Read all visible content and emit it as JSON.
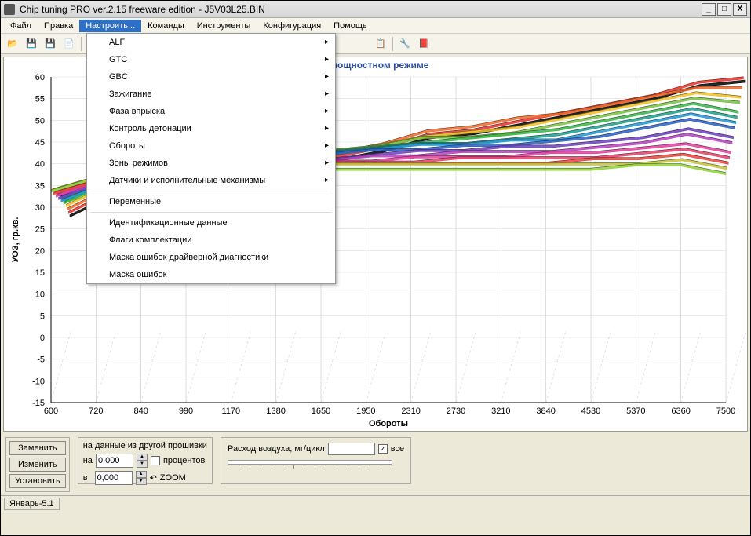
{
  "window": {
    "title": "Chip tuning PRO ver.2.15 freeware edition  -  J5V03L25.BIN"
  },
  "menubar": {
    "items": [
      "Файл",
      "Правка",
      "Настроить...",
      "Команды",
      "Инструменты",
      "Конфигурация",
      "Помощь"
    ],
    "active_index": 2
  },
  "dropdown": {
    "items": [
      {
        "label": "ALF",
        "arrow": true
      },
      {
        "label": "GTC",
        "arrow": true
      },
      {
        "label": "GBC",
        "arrow": true
      },
      {
        "label": "Зажигание",
        "arrow": true
      },
      {
        "label": "Фаза впрыска",
        "arrow": true
      },
      {
        "label": "Контроль детонации",
        "arrow": true
      },
      {
        "label": "Обороты",
        "arrow": true
      },
      {
        "label": "Зоны режимов",
        "arrow": true
      },
      {
        "label": "Датчики и исполнительные механизмы",
        "arrow": true
      },
      {
        "sep": true
      },
      {
        "label": "Переменные",
        "arrow": false
      },
      {
        "sep": true
      },
      {
        "label": "Идентификационные данные",
        "arrow": false
      },
      {
        "label": "Флаги комплектации",
        "arrow": false
      },
      {
        "label": "Маска ошибок драйверной диагностики",
        "arrow": false
      },
      {
        "label": "Маска ошибок",
        "arrow": false
      }
    ]
  },
  "chart_data": {
    "type": "line",
    "title": "в мощностном режиме",
    "xlabel": "Обороты",
    "ylabel": "УОЗ, гр.кв.",
    "x_ticks": [
      600,
      720,
      840,
      990,
      1170,
      1380,
      1650,
      1950,
      2310,
      2730,
      3210,
      3840,
      4530,
      5370,
      6360,
      7500
    ],
    "y_ticks": [
      -15,
      -10,
      -5,
      0,
      5,
      10,
      15,
      20,
      25,
      30,
      35,
      40,
      45,
      50,
      55,
      60
    ],
    "ylim": [
      -15,
      60
    ],
    "series": [
      {
        "name": "s1",
        "color": "#000000",
        "values": [
          25,
          30,
          34,
          36,
          36,
          37,
          38,
          40,
          43,
          44,
          46,
          48,
          50,
          52,
          55,
          56
        ]
      },
      {
        "name": "s2",
        "color": "#e8332b",
        "values": [
          26,
          31,
          35,
          37,
          37,
          38,
          39,
          41,
          44,
          45,
          47,
          49,
          51,
          53,
          56,
          57
        ]
      },
      {
        "name": "s3",
        "color": "#f06a2a",
        "values": [
          27,
          32,
          36,
          38,
          38,
          39,
          40,
          42,
          45,
          46,
          48,
          49,
          51,
          53,
          55,
          55
        ]
      },
      {
        "name": "s4",
        "color": "#f2c027",
        "values": [
          28,
          33,
          36,
          38,
          39,
          40,
          40,
          42,
          44,
          45,
          46,
          48,
          50,
          52,
          54,
          53
        ]
      },
      {
        "name": "s5",
        "color": "#7ac142",
        "values": [
          29,
          33,
          37,
          38,
          39,
          40,
          41,
          42,
          44,
          44,
          45,
          47,
          49,
          51,
          53,
          52
        ]
      },
      {
        "name": "s6",
        "color": "#3ab54a",
        "values": [
          29,
          34,
          37,
          39,
          39,
          40,
          41,
          42,
          43,
          44,
          45,
          46,
          48,
          50,
          52,
          50
        ]
      },
      {
        "name": "s7",
        "color": "#1e9e8b",
        "values": [
          30,
          34,
          37,
          39,
          39,
          40,
          41,
          42,
          43,
          43,
          44,
          45,
          47,
          49,
          51,
          49
        ]
      },
      {
        "name": "s8",
        "color": "#2196d4",
        "values": [
          30,
          34,
          38,
          39,
          40,
          40,
          41,
          42,
          43,
          43,
          44,
          44,
          46,
          48,
          50,
          48
        ]
      },
      {
        "name": "s9",
        "color": "#2a5fc0",
        "values": [
          31,
          35,
          38,
          39,
          40,
          40,
          41,
          42,
          42,
          43,
          43,
          44,
          45,
          47,
          49,
          47
        ]
      },
      {
        "name": "s10",
        "color": "#6b3fbf",
        "values": [
          31,
          35,
          38,
          39,
          40,
          40,
          40,
          41,
          42,
          42,
          43,
          43,
          44,
          45,
          47,
          45
        ]
      },
      {
        "name": "s11",
        "color": "#b53fbf",
        "values": [
          32,
          35,
          38,
          39,
          40,
          40,
          40,
          41,
          41,
          42,
          42,
          42,
          43,
          44,
          46,
          44
        ]
      },
      {
        "name": "s12",
        "color": "#e13f9e",
        "values": [
          32,
          36,
          38,
          39,
          40,
          40,
          40,
          40,
          41,
          41,
          41,
          42,
          42,
          43,
          44,
          42
        ]
      },
      {
        "name": "s13",
        "color": "#e33f6a",
        "values": [
          33,
          36,
          38,
          39,
          40,
          40,
          40,
          40,
          40,
          41,
          41,
          41,
          41,
          42,
          43,
          41
        ]
      },
      {
        "name": "s14",
        "color": "#e8443a",
        "values": [
          33,
          36,
          38,
          39,
          40,
          40,
          40,
          40,
          40,
          40,
          40,
          40,
          41,
          41,
          42,
          40
        ]
      },
      {
        "name": "s15",
        "color": "#c2c23a",
        "values": [
          34,
          37,
          38,
          39,
          40,
          40,
          40,
          40,
          40,
          40,
          40,
          40,
          40,
          40,
          41,
          39
        ]
      },
      {
        "name": "s16",
        "color": "#8fd13a",
        "values": [
          34,
          37,
          38,
          39,
          39,
          39,
          39,
          39,
          39,
          39,
          39,
          39,
          39,
          40,
          40,
          38
        ]
      }
    ]
  },
  "bottom": {
    "buttons": {
      "replace": "Заменить",
      "change": "Изменить",
      "set": "Установить"
    },
    "other_label": "на данные из другой прошивки",
    "na_label": "на",
    "v_label": "в",
    "na_value": "0,000",
    "v_value": "0,000",
    "percent_label": "процентов",
    "zoom_label": "ZOOM",
    "air": {
      "label": "Расход воздуха, мг/цикл",
      "value": "",
      "all_label": "все",
      "all_checked": true
    }
  },
  "status": {
    "text": "Январь-5.1"
  }
}
